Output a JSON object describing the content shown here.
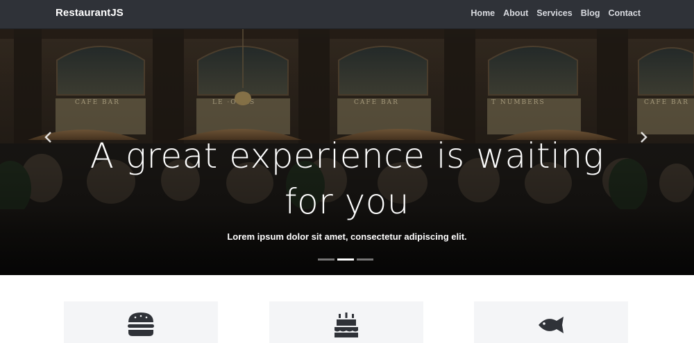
{
  "navbar": {
    "brand": "RestaurantJS",
    "links": [
      "Home",
      "About",
      "Services",
      "Blog",
      "Contact"
    ]
  },
  "hero": {
    "title_line1": "A great experience is waiting",
    "title_line2": "for you",
    "subtitle": "Lorem ipsum dolor sit amet, consectetur adipiscing elit.",
    "prev_icon": "chevron-left-icon",
    "next_icon": "chevron-right-icon",
    "slide_count": 3,
    "active_slide": 2
  },
  "features": {
    "cards": [
      {
        "icon": "burger-icon"
      },
      {
        "icon": "cake-icon"
      },
      {
        "icon": "fish-icon"
      }
    ]
  },
  "colors": {
    "navbar_bg": "#2f3238",
    "card_bg": "#f4f5f7",
    "icon_color": "#2f3238"
  }
}
